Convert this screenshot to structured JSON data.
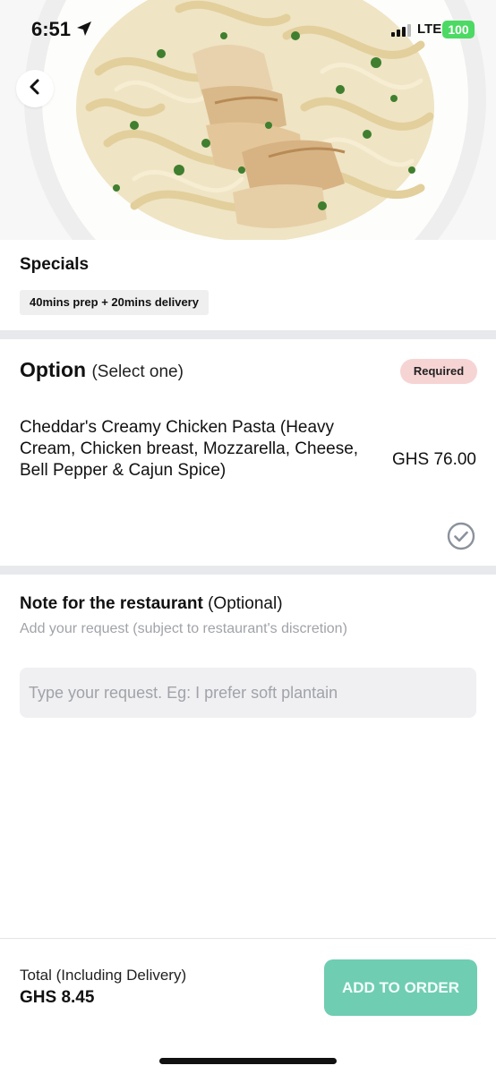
{
  "status_bar": {
    "time": "6:51",
    "network": "LTE",
    "battery": "100"
  },
  "icons": {
    "back": "chevron-left-icon",
    "location": "location-arrow-icon",
    "check": "check-circle-icon",
    "signal": "signal-bars-icon"
  },
  "colors": {
    "accent": "#6fcdb2",
    "required_badge_bg": "#f7d4d4",
    "divider": "#e8e9ec",
    "battery": "#4cd964"
  },
  "item": {
    "category": "Specials",
    "prep_info": "40mins prep + 20mins delivery"
  },
  "option": {
    "title": "Option",
    "subtitle": "(Select one)",
    "required_label": "Required",
    "name": "Cheddar's Creamy Chicken Pasta (Heavy Cream, Chicken breast, Mozzarella, Cheese, Bell Pepper & Cajun Spice)",
    "price": "GHS 76.00"
  },
  "note": {
    "title": "Note for the restaurant",
    "optional": "(Optional)",
    "help": "Add your request (subject to restaurant's discretion)",
    "placeholder": "Type your request. Eg: I prefer soft plantain"
  },
  "footer": {
    "total_label": "Total (Including Delivery)",
    "total_value": "GHS 8.45",
    "add_button": "ADD TO ORDER"
  }
}
